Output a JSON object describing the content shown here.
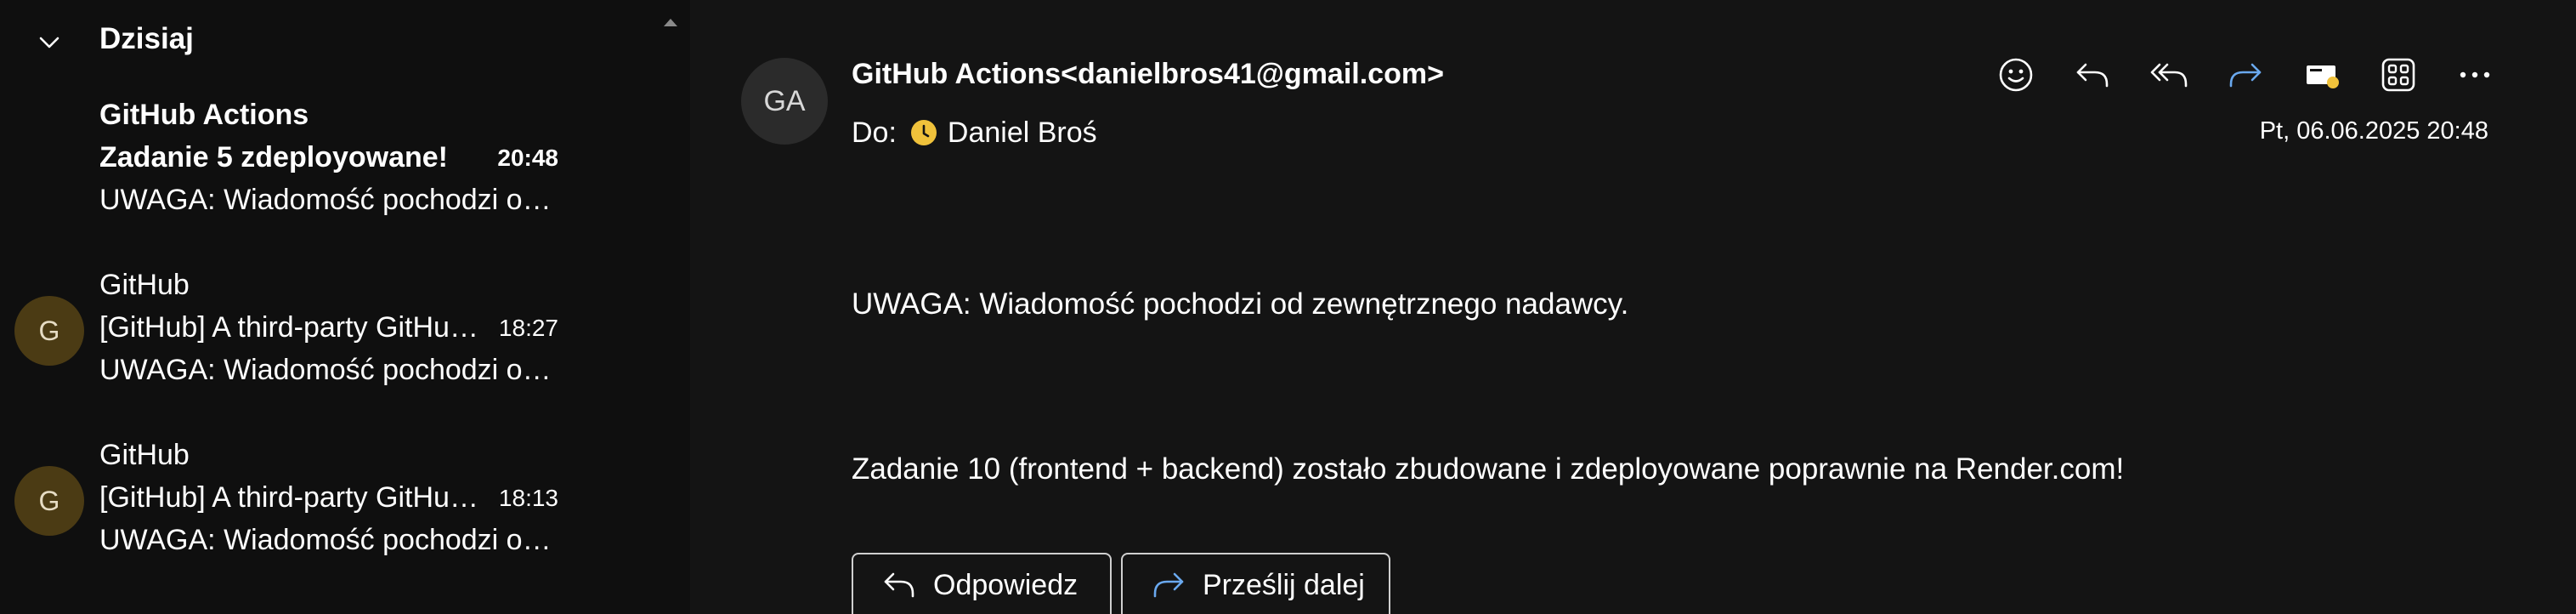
{
  "list": {
    "group_label": "Dzisiaj",
    "messages": [
      {
        "sender": "GitHub Actions",
        "subject": "Zadanie 5 zdeployowane!",
        "time": "20:48",
        "preview": "UWAGA: Wiadomość pochodzi od zewnętrznego nadawcy.",
        "avatar": ""
      },
      {
        "sender": "GitHub",
        "subject": "[GitHub] A third-party GitHub Application has been added to your account",
        "time": "18:27",
        "preview": "UWAGA: Wiadomość pochodzi od zewnętrznego nadawcy.",
        "avatar": "G"
      },
      {
        "sender": "GitHub",
        "subject": "[GitHub] A third-party GitHub Application has been added to your account",
        "time": "18:13",
        "preview": "UWAGA: Wiadomość pochodzi od zewnętrznego nadawcy.",
        "avatar": "G"
      }
    ]
  },
  "message": {
    "avatar_initials": "GA",
    "from": "GitHub Actions<danielbros41@gmail.com>",
    "to_label": "Do:",
    "to_name": "Daniel Broś",
    "date": "Pt, 06.06.2025 20:48",
    "body_line1": "UWAGA: Wiadomość pochodzi od zewnętrznego nadawcy.",
    "body_line2": "Zadanie 10 (frontend + backend) zostało zbudowane i zdeployowane poprawnie na Render.com!",
    "reply_label": "Odpowiedz",
    "forward_label": "Prześlij dalej"
  },
  "toolbar_icons": [
    "emoji-icon",
    "reply-icon",
    "reply-all-icon",
    "forward-icon",
    "apps-badge-icon",
    "grid-icon",
    "more-icon"
  ],
  "colors": {
    "list_background": "#0f0f0f",
    "reading_background": "#141414",
    "forward_accent": "#6aa9ef",
    "presence_yellow": "#f0c23b",
    "avatar_brown": "#4b3b14"
  }
}
